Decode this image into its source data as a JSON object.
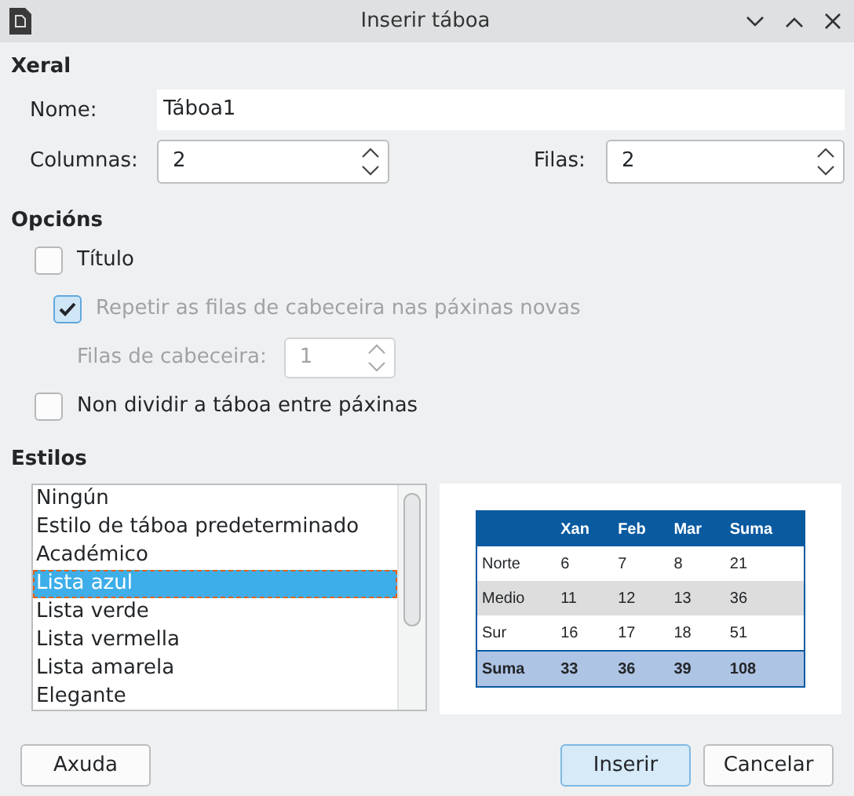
{
  "window": {
    "title": "Inserir táboa"
  },
  "general": {
    "heading": "Xeral",
    "name_label": "Nome:",
    "name_value": "Táboa1",
    "columns_label": "Columnas:",
    "columns_value": "2",
    "rows_label": "Filas:",
    "rows_value": "2"
  },
  "options": {
    "heading": "Opcións",
    "items": [
      {
        "kind": "checkbox",
        "label": "Título",
        "checked": false,
        "disabled": false,
        "indent": false
      },
      {
        "kind": "checkbox",
        "label": "Repetir as filas de cabeceira nas páxinas novas",
        "checked": true,
        "disabled": true,
        "indent": true
      },
      {
        "kind": "spin",
        "label": "Filas de cabeceira:",
        "value": "1",
        "disabled": true
      },
      {
        "kind": "checkbox",
        "label": "Non dividir a táboa entre páxinas",
        "checked": false,
        "disabled": false,
        "indent": false
      }
    ]
  },
  "styles": {
    "heading": "Estilos",
    "items": [
      {
        "label": "Ningún",
        "selected": false
      },
      {
        "label": "Estilo de táboa predeterminado",
        "selected": false
      },
      {
        "label": "Académico",
        "selected": false
      },
      {
        "label": "Lista azul",
        "selected": true
      },
      {
        "label": "Lista verde",
        "selected": false
      },
      {
        "label": "Lista vermella",
        "selected": false
      },
      {
        "label": "Lista amarela",
        "selected": false
      },
      {
        "label": "Elegante",
        "selected": false
      }
    ]
  },
  "preview": {
    "header": [
      "Xan",
      "Feb",
      "Mar",
      "Suma"
    ],
    "rows": [
      [
        "Norte",
        "6",
        "7",
        "8",
        "21"
      ],
      [
        "Medio",
        "11",
        "12",
        "13",
        "36"
      ],
      [
        "Sur",
        "16",
        "17",
        "18",
        "51"
      ]
    ],
    "total": [
      "Suma",
      "33",
      "36",
      "39",
      "108"
    ]
  },
  "buttons": [
    {
      "label": "Axuda",
      "default": false
    },
    {
      "label": "Inserir",
      "default": true
    },
    {
      "label": "Cancelar",
      "default": false
    }
  ]
}
